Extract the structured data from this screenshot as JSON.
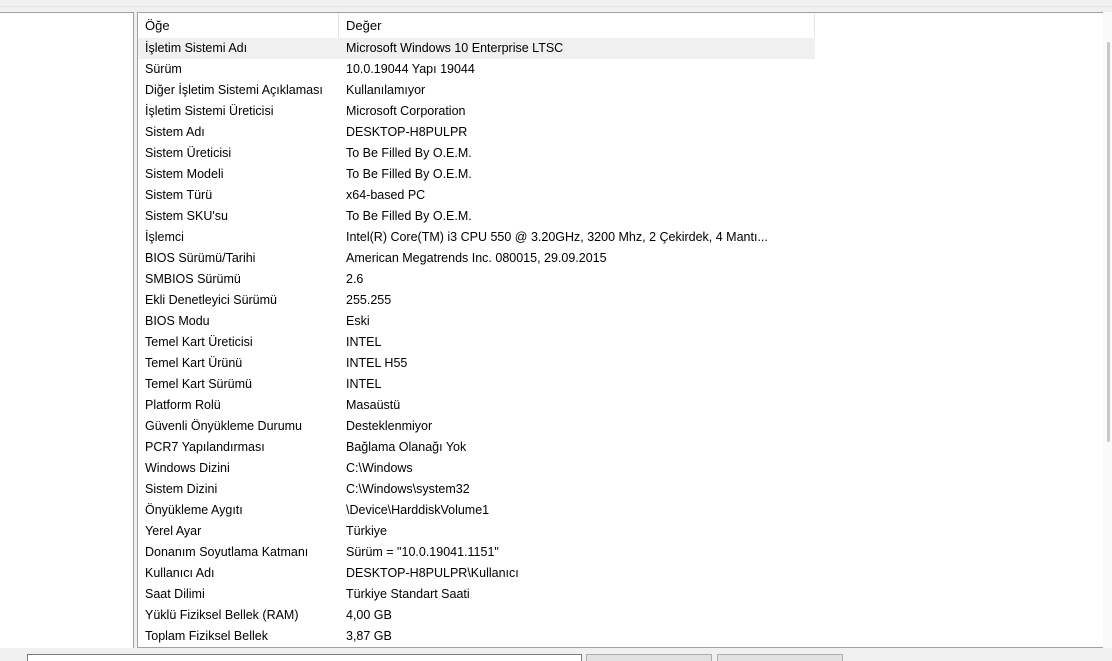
{
  "columns": {
    "item": "Öğe",
    "value": "Değer"
  },
  "rows": [
    {
      "item": "İşletim Sistemi Adı",
      "value": "Microsoft Windows 10 Enterprise LTSC"
    },
    {
      "item": "Sürüm",
      "value": "10.0.19044 Yapı 19044"
    },
    {
      "item": "Diğer İşletim Sistemi Açıklaması",
      "value": "Kullanılamıyor"
    },
    {
      "item": "İşletim Sistemi Üreticisi",
      "value": "Microsoft Corporation"
    },
    {
      "item": "Sistem Adı",
      "value": "DESKTOP-H8PULPR"
    },
    {
      "item": "Sistem Üreticisi",
      "value": "To Be Filled By O.E.M."
    },
    {
      "item": "Sistem Modeli",
      "value": "To Be Filled By O.E.M."
    },
    {
      "item": "Sistem Türü",
      "value": "x64-based PC"
    },
    {
      "item": "Sistem SKU'su",
      "value": "To Be Filled By O.E.M."
    },
    {
      "item": "İşlemci",
      "value": "Intel(R) Core(TM) i3 CPU         550  @ 3.20GHz, 3200 Mhz, 2 Çekirdek, 4 Mantı..."
    },
    {
      "item": "BIOS Sürümü/Tarihi",
      "value": "American Megatrends Inc. 080015, 29.09.2015"
    },
    {
      "item": "SMBIOS Sürümü",
      "value": "2.6"
    },
    {
      "item": "Ekli Denetleyici Sürümü",
      "value": "255.255"
    },
    {
      "item": "BIOS Modu",
      "value": "Eski"
    },
    {
      "item": "Temel Kart Üreticisi",
      "value": "INTEL"
    },
    {
      "item": "Temel Kart Ürünü",
      "value": "INTEL H55"
    },
    {
      "item": "Temel Kart Sürümü",
      "value": "INTEL"
    },
    {
      "item": "Platform Rolü",
      "value": "Masaüstü"
    },
    {
      "item": "Güvenli Önyükleme Durumu",
      "value": "Desteklenmiyor"
    },
    {
      "item": "PCR7 Yapılandırması",
      "value": "Bağlama Olanağı Yok"
    },
    {
      "item": "Windows Dizini",
      "value": "C:\\Windows"
    },
    {
      "item": "Sistem Dizini",
      "value": "C:\\Windows\\system32"
    },
    {
      "item": "Önyükleme Aygıtı",
      "value": "\\Device\\HarddiskVolume1"
    },
    {
      "item": "Yerel Ayar",
      "value": "Türkiye"
    },
    {
      "item": "Donanım Soyutlama Katmanı",
      "value": "Sürüm = \"10.0.19041.1151\""
    },
    {
      "item": "Kullanıcı Adı",
      "value": "DESKTOP-H8PULPR\\Kullanıcı"
    },
    {
      "item": "Saat Dilimi",
      "value": "Türkiye Standart Saati"
    },
    {
      "item": "Yüklü Fiziksel Bellek (RAM)",
      "value": "4,00 GB"
    },
    {
      "item": "Toplam Fiziksel Bellek",
      "value": "3,87 GB"
    }
  ],
  "selected_row": 0
}
